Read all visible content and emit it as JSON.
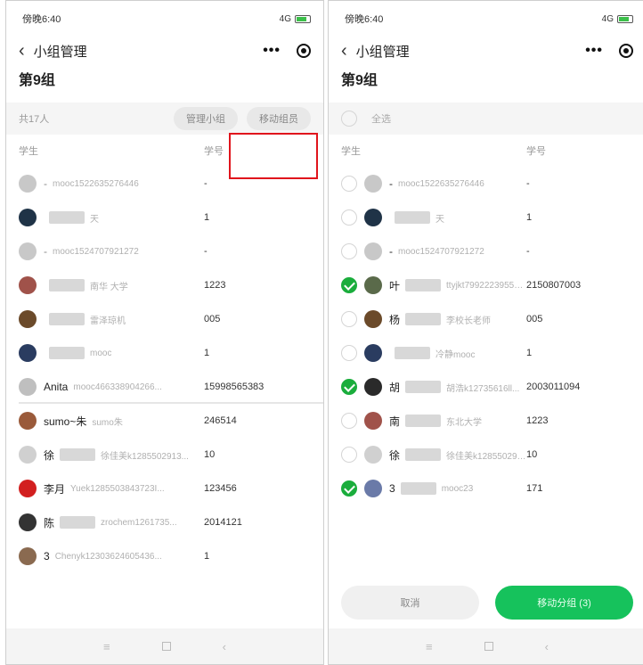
{
  "colors": {
    "accent": "#1aad3c",
    "highlight": "#e0141c"
  },
  "icons": {
    "back": "back-arrow-icon",
    "more": "more-dots-icon",
    "target": "record-icon"
  },
  "left": {
    "status_time": "傍晚6:40",
    "status_right": "4G",
    "nav_title": "小组管理",
    "group_title": "第9组",
    "count": "共17人",
    "btn_manage": "管理小组",
    "btn_move": "移动组员",
    "col_student": "学生",
    "col_id": "学号",
    "rows": [
      {
        "nick": "-",
        "account": "mooc1522635276446",
        "id": "-",
        "color": "#c8c8c8",
        "dim": true,
        "blur": false
      },
      {
        "nick": "",
        "account": "天",
        "id": "1",
        "color": "#1f3347",
        "dim": false,
        "blur": true
      },
      {
        "nick": "-",
        "account": "mooc1524707921272",
        "id": "-",
        "color": "#c8c8c8",
        "dim": true,
        "blur": false
      },
      {
        "nick": "",
        "account": "南华 大学",
        "id": "1223",
        "color": "#a0524a",
        "dim": false,
        "blur": true
      },
      {
        "nick": "",
        "account": "雷泽琼机",
        "id": "005",
        "color": "#6b4a2a",
        "dim": false,
        "blur": true
      },
      {
        "nick": "",
        "account": "mooc",
        "id": "1",
        "color": "#2a3c60",
        "dim": false,
        "blur": true
      },
      {
        "nick": "Anita",
        "account": "mooc466338904266...",
        "id": "15998565383",
        "color": "#bfbfbf",
        "dim": false,
        "blur": false
      },
      {
        "nick": "sumo~朱",
        "account": "sumo朱",
        "id": "246514",
        "color": "#9a5a3a",
        "dim": false,
        "blur": false
      },
      {
        "nick": "徐",
        "account": "徐佳美k1285502913...",
        "id": "10",
        "color": "#d0d0d0",
        "dim": false,
        "blur": true
      },
      {
        "nick": "李月",
        "account": "Yuek1285503843723I...",
        "id": "123456",
        "color": "#d21f1f",
        "dim": false,
        "blur": false
      },
      {
        "nick": "陈",
        "account": "zrochem1261735...",
        "id": "2014121",
        "color": "#333333",
        "dim": false,
        "blur": true
      },
      {
        "nick": "3",
        "account": "Chenyk12303624605436...",
        "id": "1",
        "color": "#8a6a50",
        "dim": false,
        "blur": false
      }
    ]
  },
  "right": {
    "status_time": "傍晚6:40",
    "status_right": "4G",
    "nav_title": "小组管理",
    "group_title": "第9组",
    "select_all": "全选",
    "col_student": "学生",
    "col_id": "学号",
    "rows": [
      {
        "nick": "-",
        "account": "mooc1522635276446",
        "id": "-",
        "color": "#c8c8c8",
        "checked": false,
        "blur": false
      },
      {
        "nick": "",
        "account": "天",
        "id": "1",
        "color": "#1f3347",
        "checked": false,
        "blur": true
      },
      {
        "nick": "-",
        "account": "mooc1524707921272",
        "id": "-",
        "color": "#c8c8c8",
        "checked": false,
        "blur": false
      },
      {
        "nick": "叶",
        "account": "ttyjkt799222395597...",
        "id": "2150807003",
        "color": "#5a6a4a",
        "checked": true,
        "blur": true
      },
      {
        "nick": "杨",
        "account": "李校长老师",
        "id": "005",
        "color": "#6b4a2a",
        "checked": false,
        "blur": true
      },
      {
        "nick": "",
        "account": "冷静mooc",
        "id": "1",
        "color": "#2a3c60",
        "checked": false,
        "blur": true
      },
      {
        "nick": "胡",
        "account": "胡浩k12735616ll...",
        "id": "2003011094",
        "color": "#2a2a2a",
        "checked": true,
        "blur": true
      },
      {
        "nick": "南",
        "account": "东北大学",
        "id": "1223",
        "color": "#a0524a",
        "checked": false,
        "blur": true
      },
      {
        "nick": "徐",
        "account": "徐佳美k1285502913...",
        "id": "10",
        "color": "#d0d0d0",
        "checked": false,
        "blur": true
      },
      {
        "nick": "3",
        "account": "mooc23",
        "id": "171",
        "color": "#6a7aa8",
        "checked": true,
        "blur": true
      }
    ],
    "btn_cancel": "取消",
    "btn_move_to": "移动分组 (3)"
  }
}
